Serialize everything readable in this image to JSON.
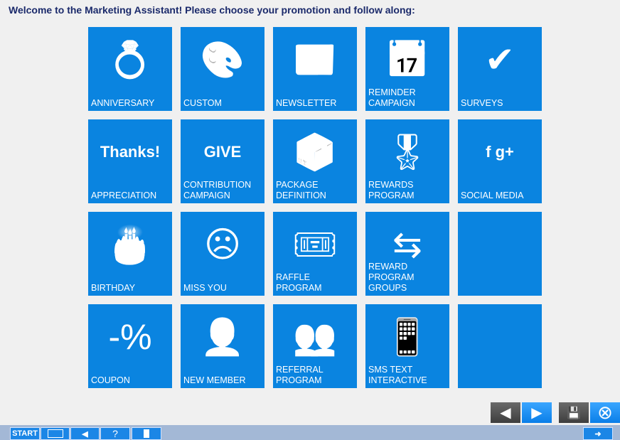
{
  "header": {
    "title": "Welcome to the Marketing Assistant!  Please choose your promotion and follow along:"
  },
  "tiles": [
    {
      "label": "Anniversary",
      "icon": "rings-icon",
      "glyph": "💍"
    },
    {
      "label": "Custom",
      "icon": "palette-icon",
      "glyph": "🎨"
    },
    {
      "label": "Newsletter",
      "icon": "newspaper-icon",
      "glyph": "📰"
    },
    {
      "label": "Reminder Campaign",
      "icon": "calendar-clock-icon",
      "glyph": "📅"
    },
    {
      "label": "Surveys",
      "icon": "checklist-icon",
      "glyph": "✔"
    },
    {
      "label": "Appreciation",
      "icon": "thanks-bubble-icon",
      "glyph": "Thanks!"
    },
    {
      "label": "Contribution Campaign",
      "icon": "give-hand-icon",
      "glyph": "GIVE"
    },
    {
      "label": "Package Definition",
      "icon": "box-icon",
      "glyph": "📦"
    },
    {
      "label": "Rewards Program",
      "icon": "ribbon-icon",
      "glyph": "🎖"
    },
    {
      "label": "Social Media",
      "icon": "social-media-icon",
      "glyph": "f g+"
    },
    {
      "label": "Birthday",
      "icon": "cake-icon",
      "glyph": "🎂"
    },
    {
      "label": "Miss You",
      "icon": "sad-face-icon",
      "glyph": "☹"
    },
    {
      "label": "Raffle Program",
      "icon": "ticket-icon",
      "glyph": "🎟"
    },
    {
      "label": "Reward Program Groups",
      "icon": "ribbons-exchange-icon",
      "glyph": "⇆"
    },
    {
      "label": "",
      "icon": "",
      "glyph": ""
    },
    {
      "label": "Coupon",
      "icon": "coupon-icon",
      "glyph": "-%"
    },
    {
      "label": "New Member",
      "icon": "new-member-icon",
      "glyph": "👤"
    },
    {
      "label": "Referral Program",
      "icon": "group-icon",
      "glyph": "👥"
    },
    {
      "label": "SMS Text Interactive",
      "icon": "sms-phone-icon",
      "glyph": "📱"
    },
    {
      "label": "",
      "icon": "",
      "glyph": ""
    }
  ],
  "nav": {
    "prev": "◀",
    "next": "▶",
    "save": "💾",
    "close": "⊗"
  },
  "taskbar": {
    "start": "START",
    "question": "?"
  },
  "colors": {
    "tile": "#0a84e0",
    "title": "#1b2a6b",
    "taskbar": "#a3b8d6"
  }
}
